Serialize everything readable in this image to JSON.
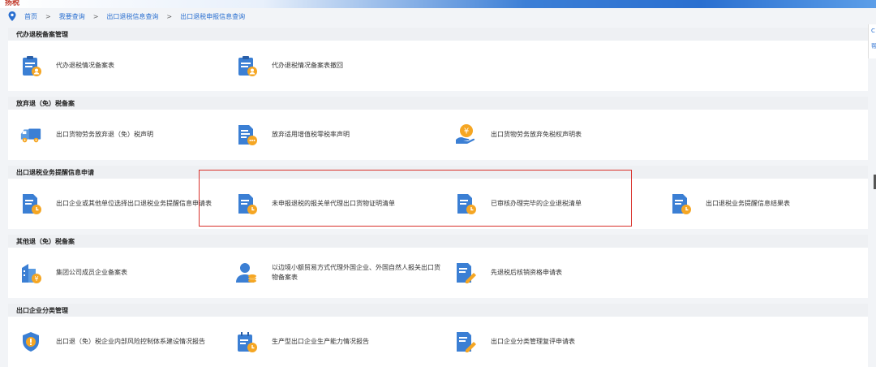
{
  "header": {
    "logo_fragment": "扬税"
  },
  "breadcrumb": [
    "首页",
    "我要查询",
    "出口退税信息查询",
    "出口退税申报信息查询"
  ],
  "sections": [
    {
      "title": "代办退税备案管理",
      "items": [
        {
          "label": "代办退税情况备案表",
          "icon": "clipboard-user-icon"
        },
        {
          "label": "代办退税情况备案表撤回",
          "icon": "clipboard-user-icon"
        }
      ]
    },
    {
      "title": "放弃退（免）税备案",
      "items": [
        {
          "label": "出口货物劳务放弃退（免）税声明",
          "icon": "truck-icon"
        },
        {
          "label": "放弃适用增值税零税率声明",
          "icon": "document-chat-icon"
        },
        {
          "label": "出口货物劳务放弃免税权声明表",
          "icon": "money-hand-icon"
        }
      ]
    },
    {
      "title": "出口退税业务提醒信息申请",
      "items": [
        {
          "label": "出口企业或其他单位选择出口退税业务提醒信息申请表",
          "icon": "document-clock-icon"
        },
        {
          "label": "未申报退税的报关单代理出口货物证明清单",
          "icon": "document-clock-icon"
        },
        {
          "label": "已审核办理完毕的企业退税清单",
          "icon": "document-clock-icon"
        },
        {
          "label": "出口退税业务提醒信息结果表",
          "icon": "document-clock-icon"
        }
      ]
    },
    {
      "title": "其他退（免）税备案",
      "items": [
        {
          "label": "集团公司成员企业备案表",
          "icon": "building-yuan-icon"
        },
        {
          "label": "以边境小额贸易方式代理外国企业、外国自然人报关出口货物备案表",
          "icon": "person-coins-icon"
        },
        {
          "label": "先退税后核销资格申请表",
          "icon": "document-pen-icon"
        }
      ]
    },
    {
      "title": "出口企业分类管理",
      "items": [
        {
          "label": "出口退（免）税企业内部风险控制体系建设情况报告",
          "icon": "shield-exclamation-icon"
        },
        {
          "label": "生产型出口企业生产能力情况报告",
          "icon": "calendar-clock-icon"
        },
        {
          "label": "出口企业分类管理复评申请表",
          "icon": "document-pen-icon"
        }
      ]
    }
  ],
  "side_tab": {
    "top_char": "C",
    "bottom_char": "帮"
  },
  "colors": {
    "accent": "#3b7fd4",
    "orange": "#f5a623",
    "highlight_border": "#d9302a"
  }
}
